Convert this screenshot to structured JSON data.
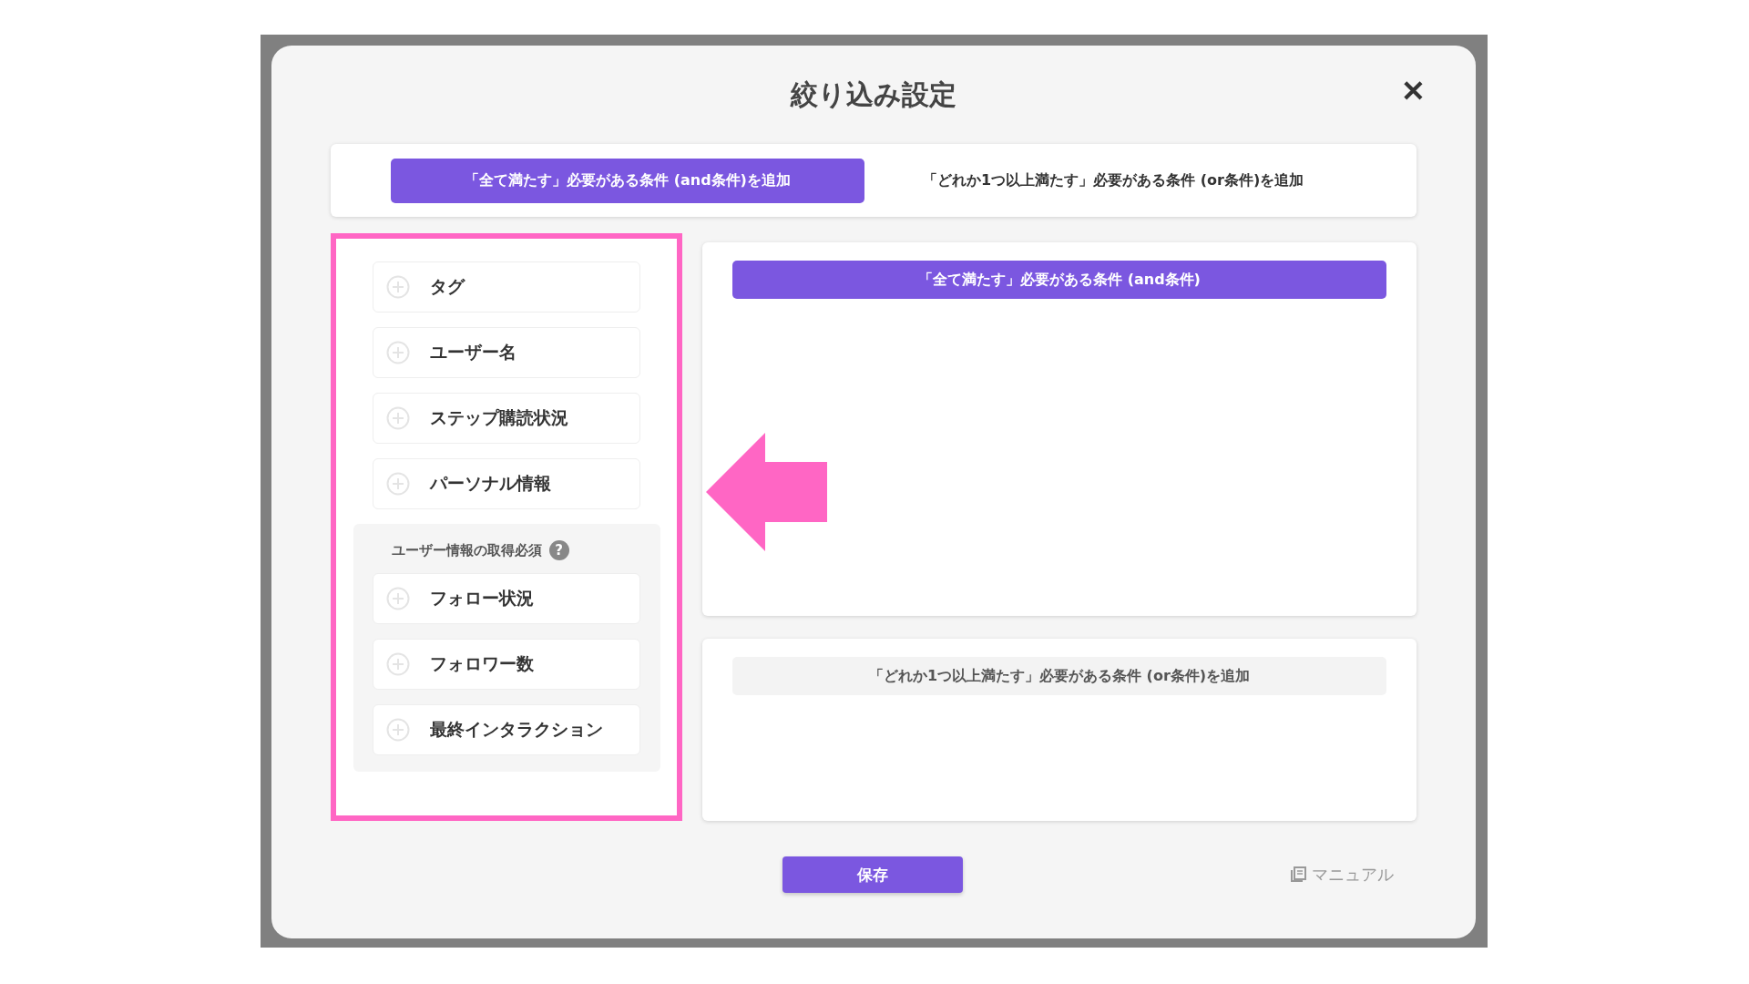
{
  "dialog": {
    "title": "絞り込み設定",
    "close": "✕"
  },
  "tabs": [
    {
      "label": "「全て満たす」必要がある条件 (and条件)を追加",
      "selected": true
    },
    {
      "label": "「どれか1つ以上満たす」必要がある条件 (or条件)を追加",
      "selected": false
    }
  ],
  "condition_items": [
    {
      "label": "タグ"
    },
    {
      "label": "ユーザー名"
    },
    {
      "label": "ステップ購読状況"
    },
    {
      "label": "パーソナル情報"
    }
  ],
  "user_info_group": {
    "label": "ユーザー情報の取得必須",
    "help": "?",
    "items": [
      {
        "label": "フォロー状況"
      },
      {
        "label": "フォロワー数"
      },
      {
        "label": "最終インタラクション"
      }
    ]
  },
  "and_section": {
    "header": "「全て満たす」必要がある条件 (and条件)",
    "active": true
  },
  "or_section": {
    "header": "「どれか1つ以上満たす」必要がある条件 (or条件)を追加",
    "active": false
  },
  "save_button": "保存",
  "manual_link": "マニュアル"
}
